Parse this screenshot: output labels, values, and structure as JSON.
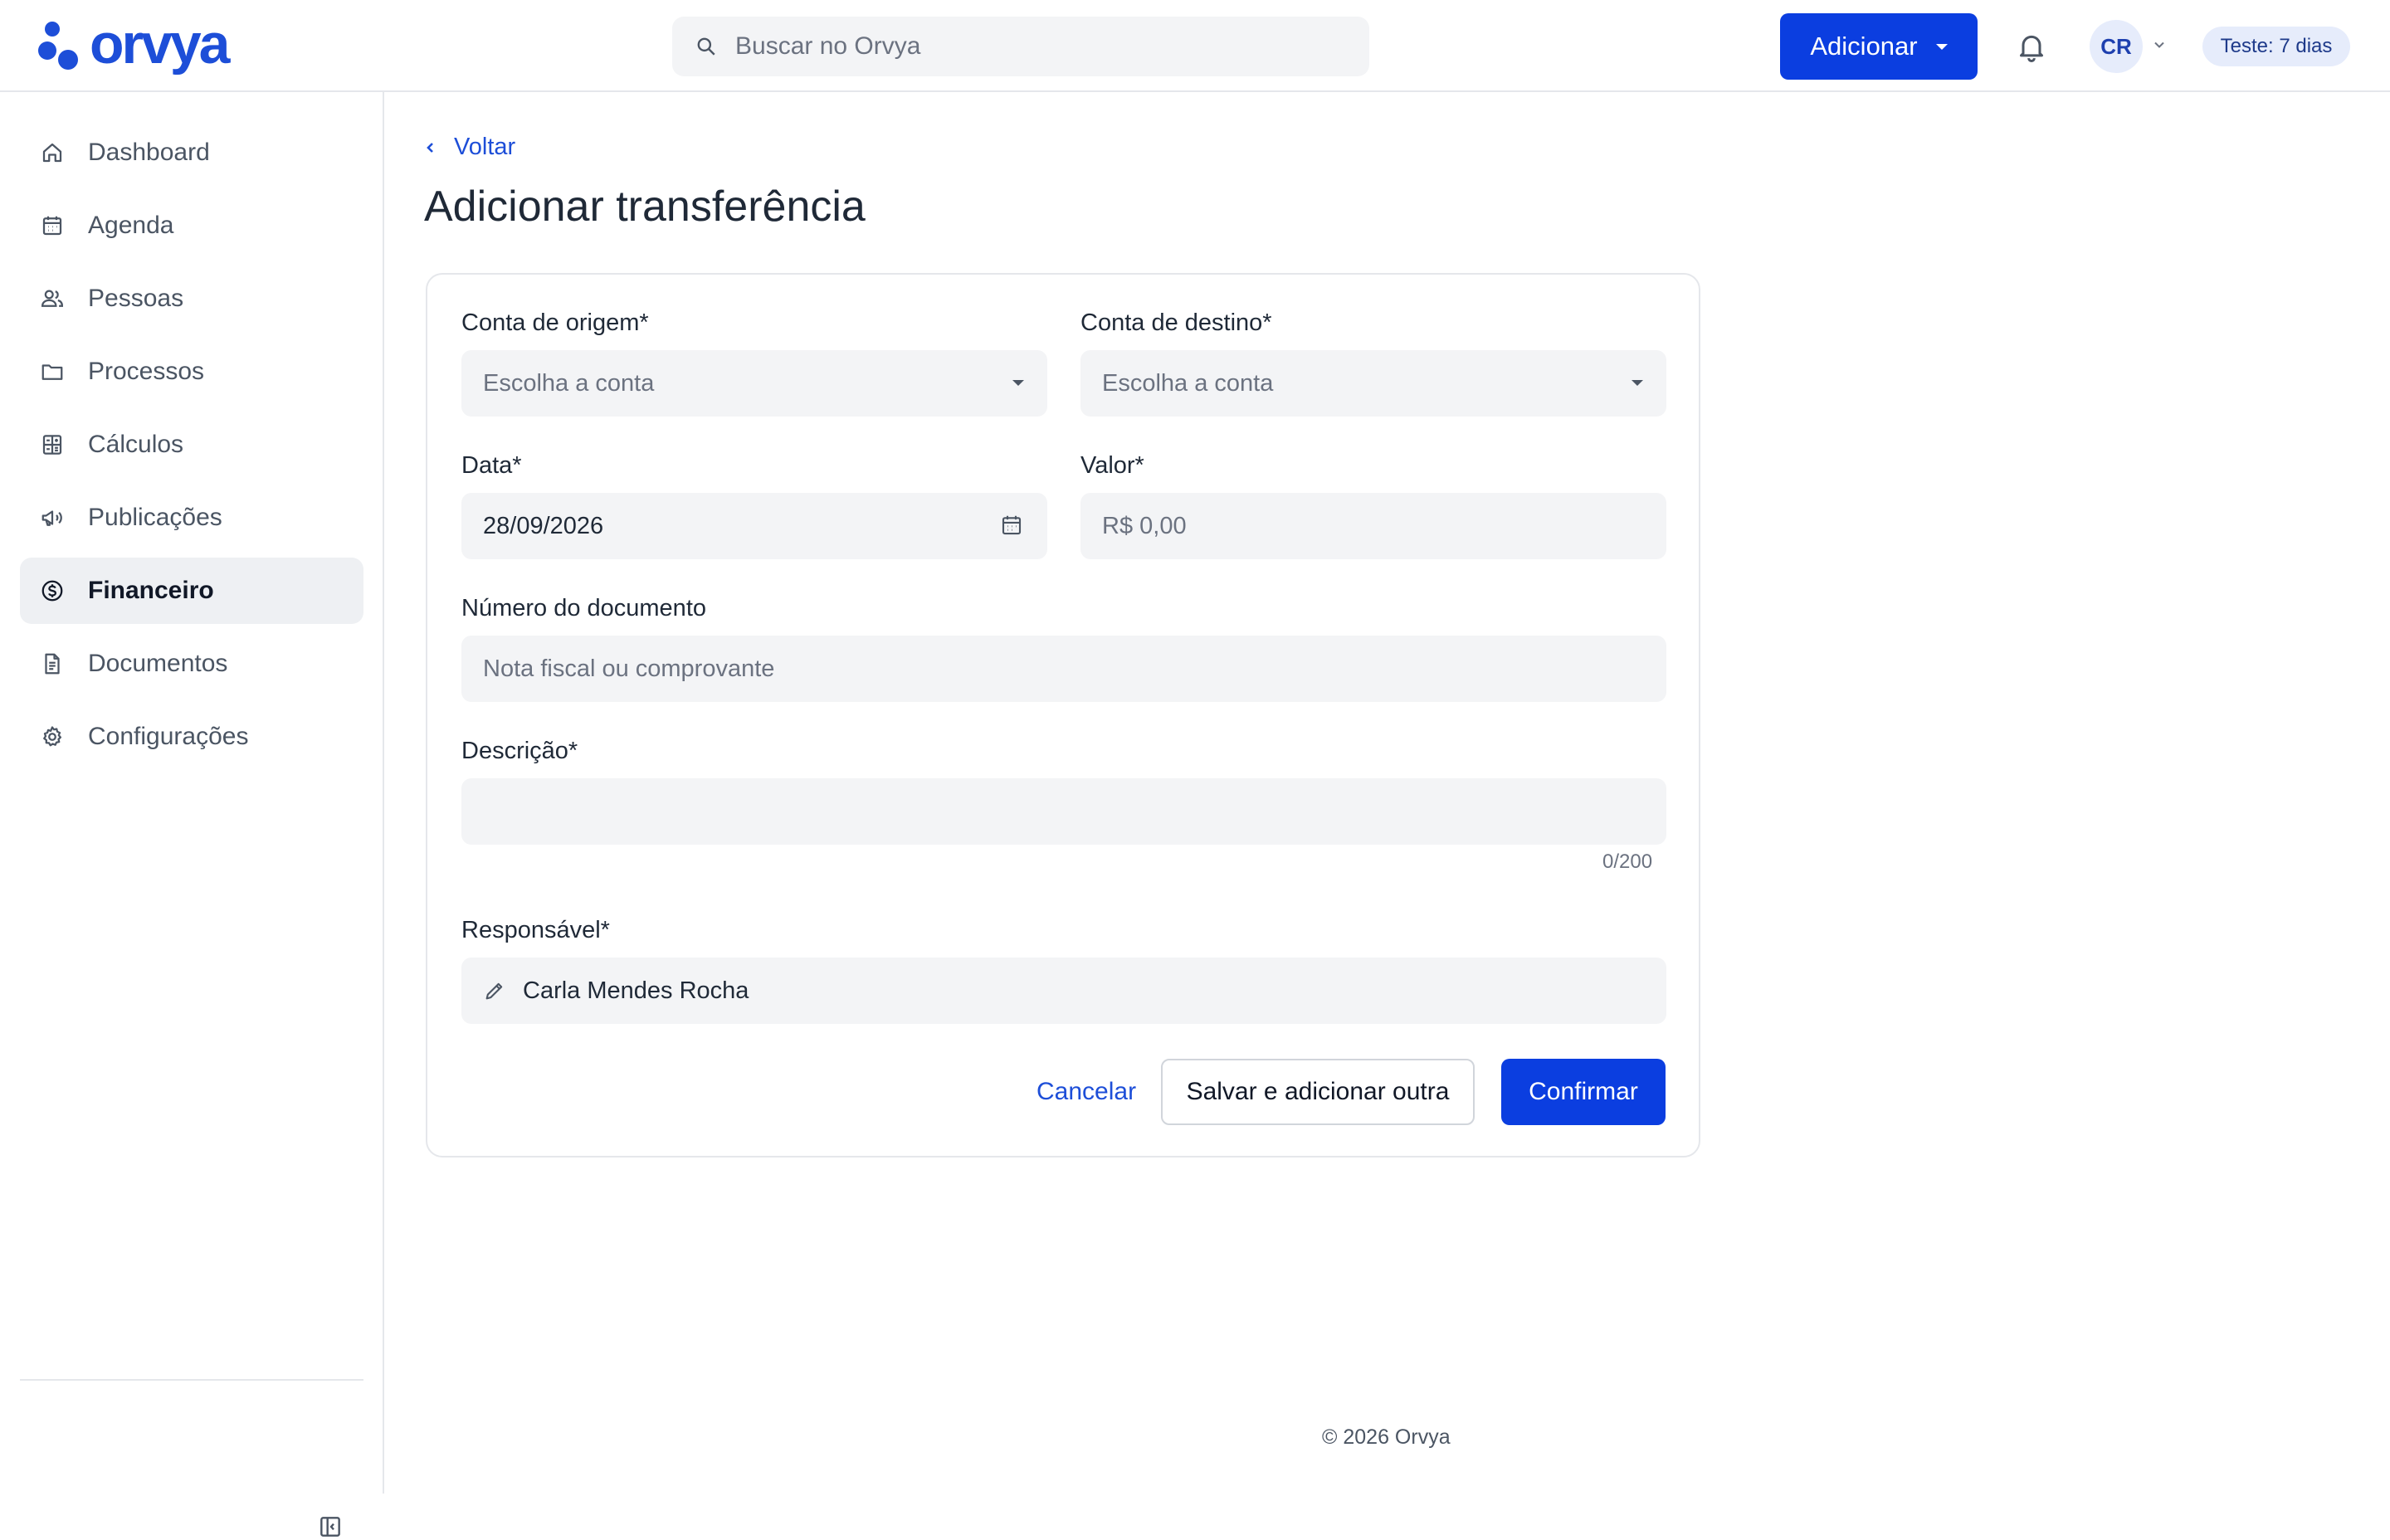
{
  "app": {
    "logo_text": "orvya",
    "brand_color": "#0b3ee0"
  },
  "header": {
    "search_placeholder": "Buscar no Orvya",
    "add_label": "Adicionar",
    "avatar_initials": "CR",
    "trial_badge": "Teste: 7 dias"
  },
  "sidebar": {
    "items": [
      {
        "label": "Dashboard",
        "icon": "home-icon"
      },
      {
        "label": "Agenda",
        "icon": "calendar-icon"
      },
      {
        "label": "Pessoas",
        "icon": "people-icon"
      },
      {
        "label": "Processos",
        "icon": "folder-icon"
      },
      {
        "label": "Cálculos",
        "icon": "calculator-icon"
      },
      {
        "label": "Publicações",
        "icon": "megaphone-icon"
      },
      {
        "label": "Financeiro",
        "icon": "dollar-icon",
        "active": true
      },
      {
        "label": "Documentos",
        "icon": "document-icon"
      },
      {
        "label": "Configurações",
        "icon": "gear-icon"
      }
    ]
  },
  "page": {
    "back_label": "Voltar",
    "title": "Adicionar transferência"
  },
  "form": {
    "origin_label": "Conta de origem*",
    "origin_placeholder": "Escolha a conta",
    "destination_label": "Conta de destino*",
    "destination_placeholder": "Escolha a conta",
    "date_label": "Data*",
    "date_value": "28/09/2026",
    "value_label": "Valor*",
    "value_placeholder": "R$ 0,00",
    "doc_number_label": "Número do documento",
    "doc_number_placeholder": "Nota fiscal ou comprovante",
    "description_label": "Descrição*",
    "description_value": "",
    "description_counter": "0/200",
    "responsible_label": "Responsável*",
    "responsible_value": "Carla Mendes Rocha",
    "cancel_label": "Cancelar",
    "save_add_label": "Salvar e adicionar outra",
    "confirm_label": "Confirmar"
  },
  "footer": {
    "text": "© 2026 Orvya"
  }
}
